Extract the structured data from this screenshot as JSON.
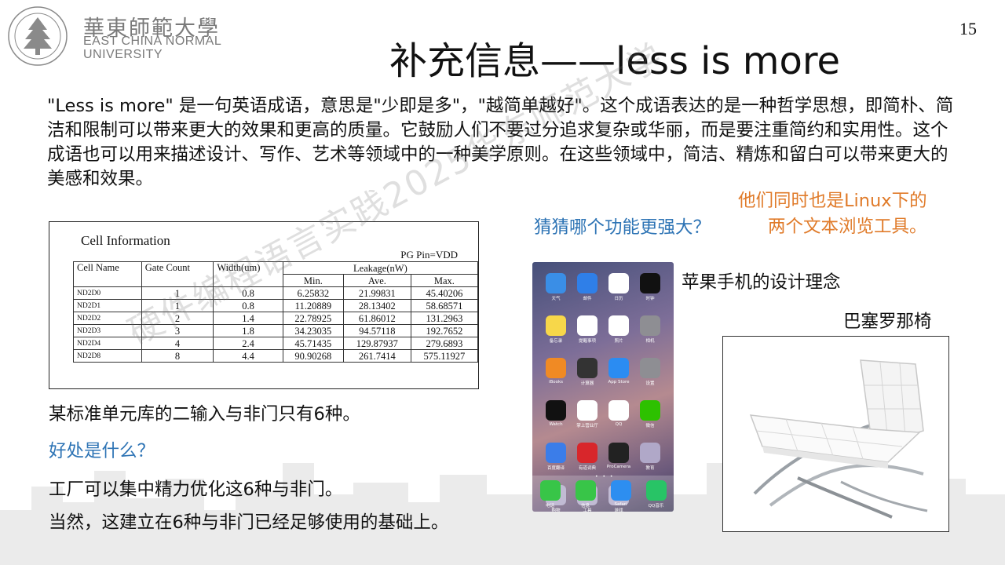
{
  "logo": {
    "name_zh": "華東師範大學",
    "name_en_line1": "EAST CHINA NORMAL",
    "name_en_line2": "UNIVERSITY",
    "icon": "pine-tree-emblem-icon"
  },
  "page_number": "15",
  "title": "补充信息——less is more",
  "intro": "\"Less is more\" 是一句英语成语，意思是\"少即是多\"，\"越简单越好\"。这个成语表达的是一种哲学思想，即简朴、简洁和限制可以带来更大的效果和更高的质量。它鼓励人们不要过分追求复杂或华丽，而是要注重简约和实用性。这个成语也可以用来描述设计、写作、艺术等领域中的一种美学原则。在这些领域中，简洁、精炼和留白可以带来更大的美感和效果。",
  "table": {
    "title": "Cell Information",
    "pg_pin": "PG Pin=VDD",
    "headers": {
      "cell_name": "Cell Name",
      "gate_count": "Gate Count",
      "width": "Width(um)",
      "leakage": "Leakage(nW)",
      "min": "Min.",
      "ave": "Ave.",
      "max": "Max."
    },
    "rows": [
      [
        "ND2D0",
        "1",
        "0.8",
        "6.25832",
        "21.99831",
        "45.40206"
      ],
      [
        "ND2D1",
        "1",
        "0.8",
        "11.20889",
        "28.13402",
        "58.68571"
      ],
      [
        "ND2D2",
        "2",
        "1.4",
        "22.78925",
        "61.86012",
        "131.2963"
      ],
      [
        "ND2D3",
        "3",
        "1.8",
        "34.23035",
        "94.57118",
        "192.7652"
      ],
      [
        "ND2D4",
        "4",
        "2.4",
        "45.71435",
        "129.87937",
        "279.6893"
      ],
      [
        "ND2D8",
        "8",
        "4.4",
        "90.90268",
        "261.7414",
        "575.11927"
      ]
    ]
  },
  "left_text": {
    "std_cell": "某标准单元库的二输入与非门只有6种。",
    "benefit_question": "好处是什么？",
    "answer1": "工厂可以集中精力优化这6种与非门。",
    "answer2": "当然，这建立在6种与非门已经足够使用的基础上。"
  },
  "right_text": {
    "guess": "猜猜哪个功能更强大？",
    "linux_line1": "他们同时也是Linux下的",
    "linux_line2": "两个文本浏览工具。",
    "apple": "苹果手机的设计理念",
    "chair": "巴塞罗那椅"
  },
  "phone": {
    "apps": [
      {
        "label": "天气",
        "color": "#3a8ee6"
      },
      {
        "label": "邮件",
        "color": "#2f7fe8"
      },
      {
        "label": "日历",
        "color": "#ffffff"
      },
      {
        "label": "时钟",
        "color": "#111111"
      },
      {
        "label": "备忘录",
        "color": "#f7d74a"
      },
      {
        "label": "提醒事项",
        "color": "#ffffff"
      },
      {
        "label": "照片",
        "color": "#ffffff"
      },
      {
        "label": "相机",
        "color": "#8e8e93"
      },
      {
        "label": "iBooks",
        "color": "#f08a24"
      },
      {
        "label": "计算器",
        "color": "#333333"
      },
      {
        "label": "App Store",
        "color": "#2b8cf2"
      },
      {
        "label": "设置",
        "color": "#8e8e93"
      },
      {
        "label": "Watch",
        "color": "#111111"
      },
      {
        "label": "掌上营业厅",
        "color": "#ffffff"
      },
      {
        "label": "QQ",
        "color": "#ffffff"
      },
      {
        "label": "微信",
        "color": "#2dc100"
      },
      {
        "label": "百度翻译",
        "color": "#3b7de9"
      },
      {
        "label": "有道词典",
        "color": "#d8262b"
      },
      {
        "label": "ProCamera",
        "color": "#222222"
      },
      {
        "label": "教育",
        "color": "#b0a8c8"
      },
      {
        "label": "购物",
        "color": "#b0a8c8"
      },
      {
        "label": "工具",
        "color": "#b0a8c8"
      },
      {
        "label": "游戏",
        "color": "#b0a8c8"
      }
    ],
    "dock": [
      {
        "label": "电话",
        "color": "#38c548"
      },
      {
        "label": "信息",
        "color": "#38c548"
      },
      {
        "label": "Safari",
        "color": "#2d8ef0"
      },
      {
        "label": "QQ音乐",
        "color": "#28c466"
      }
    ]
  },
  "watermark": "硬件编程语言实践2025华东师范大学"
}
